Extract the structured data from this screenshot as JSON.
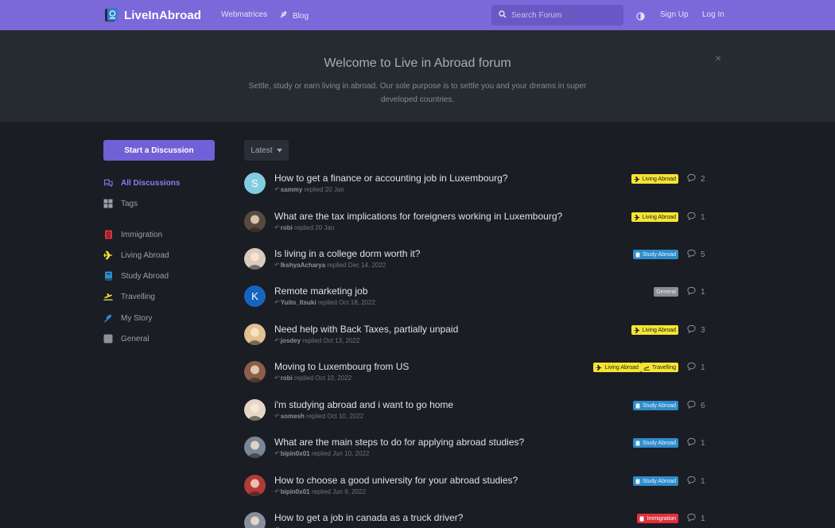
{
  "header": {
    "logo_text": "LiveInAbroad",
    "nav": [
      {
        "label": "Webmatrices"
      },
      {
        "label": "Blog"
      }
    ],
    "search_placeholder": "Search Forum",
    "sign_up": "Sign Up",
    "log_in": "Log In"
  },
  "hero": {
    "title": "Welcome to Live in Abroad forum",
    "text": "Settle, study or earn living in abroad. Our sole purpose is to settle you and your dreams in super developed countries.",
    "close": "×"
  },
  "sidebar": {
    "start_button": "Start a Discussion",
    "items": [
      {
        "label": "All Discussions",
        "icon": "chat-icon"
      },
      {
        "label": "Tags",
        "icon": "grid-icon"
      },
      {
        "label": "Immigration",
        "icon": "passport-icon",
        "color": "#e0303c"
      },
      {
        "label": "Living Abroad",
        "icon": "plane-icon",
        "color": "#f2e23a"
      },
      {
        "label": "Study Abroad",
        "icon": "book-icon",
        "color": "#2d8ccc"
      },
      {
        "label": "Travelling",
        "icon": "plane-departure-icon",
        "color": "#f2e23a"
      },
      {
        "label": "My Story",
        "icon": "feather-icon",
        "color": "#2d8ccc"
      },
      {
        "label": "General",
        "icon": "square-icon",
        "color": "#8e9196"
      }
    ]
  },
  "sort": {
    "label": "Latest"
  },
  "tag_styles": {
    "Living Abroad": {
      "bg": "#f5e532",
      "fg": "#222222",
      "icon": "plane-icon"
    },
    "Study Abroad": {
      "bg": "#2d8ccc",
      "fg": "#e8f2fb",
      "icon": "book-icon"
    },
    "General": {
      "bg": "#8a8d93",
      "fg": "#eeeeee",
      "icon": ""
    },
    "Travelling": {
      "bg": "#f5e532",
      "fg": "#222222",
      "icon": "plane-departure-icon"
    },
    "Immigration": {
      "bg": "#e0303c",
      "fg": "#ffffff",
      "icon": "passport-icon"
    }
  },
  "discussions": [
    {
      "title": "How to get a finance or accounting job in Luxembourg?",
      "user": "sammy",
      "when": "replied 20 Jan",
      "tags": [
        "Living Abroad"
      ],
      "replies": "2",
      "avatar_letter": "S",
      "avatar_color": "#82cde0"
    },
    {
      "title": "What are the tax implications for foreigners working in Luxembourg?",
      "user": "robi",
      "when": "replied 20 Jan",
      "tags": [
        "Living Abroad"
      ],
      "replies": "1",
      "avatar_letter": "",
      "avatar_color": "#5a4a3e"
    },
    {
      "title": "Is living in a college dorm worth it?",
      "user": "IkshyaAcharya",
      "when": "replied Dec 14, 2022",
      "tags": [
        "Study Abroad"
      ],
      "replies": "5",
      "avatar_letter": "",
      "avatar_color": "#d9cbbd"
    },
    {
      "title": "Remote marketing job",
      "user": "Yuito_Itsuki",
      "when": "replied Oct 18, 2022",
      "tags": [
        "General"
      ],
      "replies": "1",
      "avatar_letter": "K",
      "avatar_color": "#1565c0"
    },
    {
      "title": "Need help with Back Taxes, partially unpaid",
      "user": "josdey",
      "when": "replied Oct 13, 2022",
      "tags": [
        "Living Abroad"
      ],
      "replies": "3",
      "avatar_letter": "",
      "avatar_color": "#e2c08f"
    },
    {
      "title": "Moving to Luxembourg from US",
      "user": "robi",
      "when": "replied Oct 10, 2022",
      "tags": [
        "Living Abroad",
        "Travelling"
      ],
      "replies": "1",
      "avatar_letter": "",
      "avatar_color": "#8a5e48"
    },
    {
      "title": "i'm studying abroad and i want to go home",
      "user": "somesh",
      "when": "replied Oct 10, 2022",
      "tags": [
        "Study Abroad"
      ],
      "replies": "6",
      "avatar_letter": "",
      "avatar_color": "#e6d6c6"
    },
    {
      "title": "What are the main steps to do for applying abroad studies?",
      "user": "bipin0x01",
      "when": "replied Jun 10, 2022",
      "tags": [
        "Study Abroad"
      ],
      "replies": "1",
      "avatar_letter": "",
      "avatar_color": "#7b8796"
    },
    {
      "title": "How to choose a good university for your abroad studies?",
      "user": "bipin0x01",
      "when": "replied Jun 9, 2022",
      "tags": [
        "Study Abroad"
      ],
      "replies": "1",
      "avatar_letter": "",
      "avatar_color": "#b23a3a"
    },
    {
      "title": "How to get a job in canada as a truck driver?",
      "user": "",
      "when": "",
      "tags": [
        "Immigration"
      ],
      "replies": "1",
      "avatar_letter": "",
      "avatar_color": "#8a8e9c"
    }
  ]
}
